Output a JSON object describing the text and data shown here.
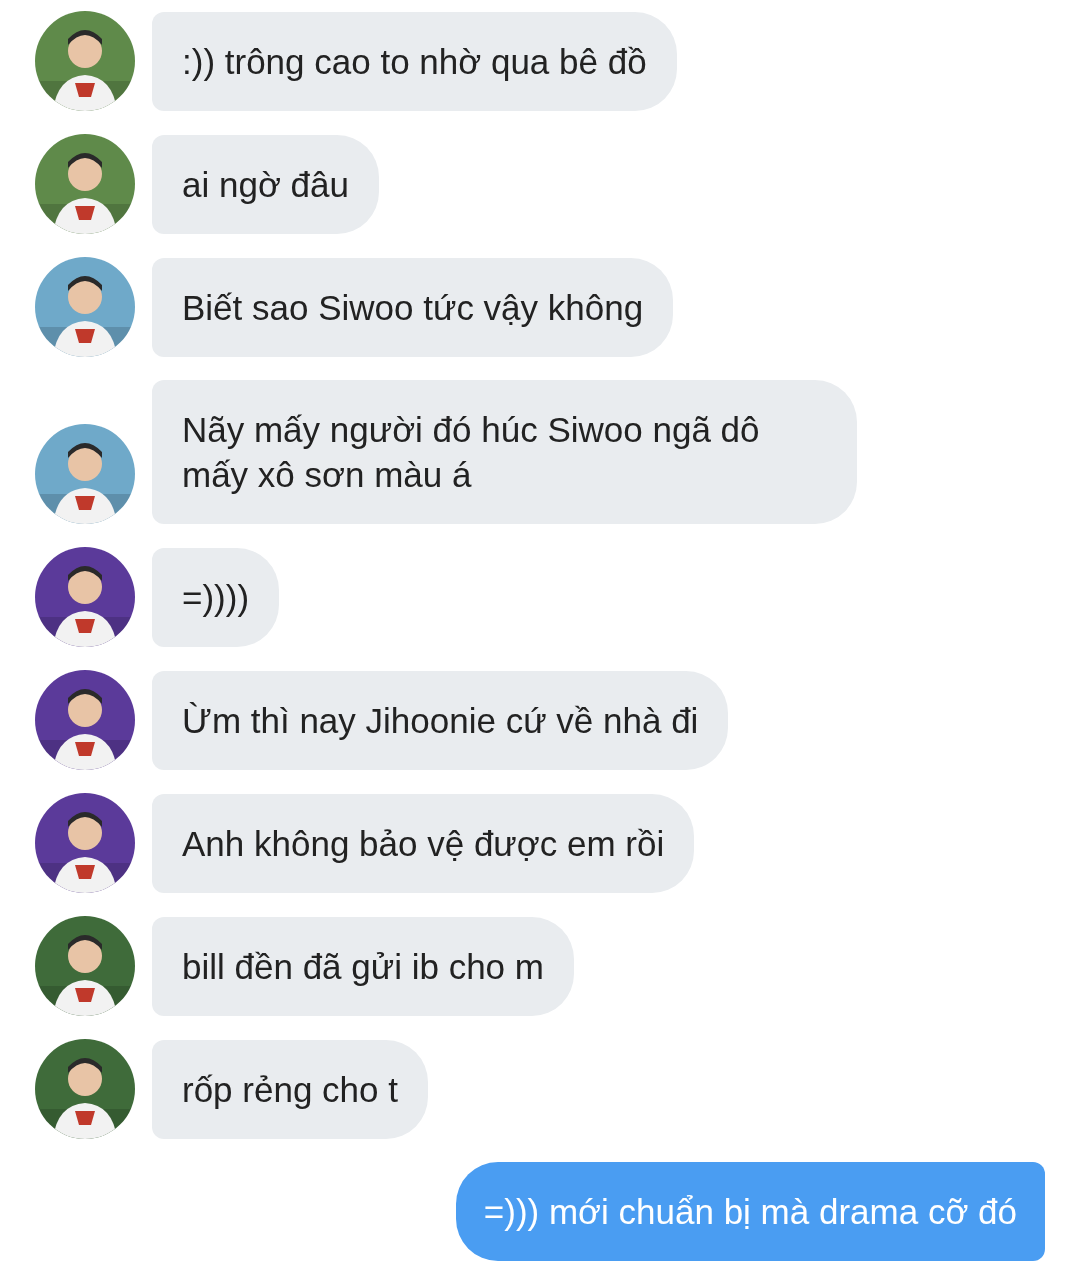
{
  "messages": [
    {
      "kind": "incoming",
      "text": ":)) trông cao to nhờ qua bê đồ"
    },
    {
      "kind": "incoming",
      "text": "ai ngờ đâu"
    },
    {
      "kind": "incoming",
      "text": "Biết sao Siwoo tức vậy không"
    },
    {
      "kind": "incoming",
      "text": "Nãy mấy người đó húc Siwoo ngã dô mấy xô sơn màu á"
    },
    {
      "kind": "incoming",
      "text": "=))))"
    },
    {
      "kind": "incoming",
      "text": "Ừm thì nay Jihoonie cứ về nhà đi"
    },
    {
      "kind": "incoming",
      "text": "Anh không bảo vệ được em rồi"
    },
    {
      "kind": "incoming",
      "text": "bill đền đã gửi ib cho m"
    },
    {
      "kind": "incoming",
      "text": "rốp rẻng cho t"
    },
    {
      "kind": "outgoing",
      "text": "=))) mới chuẩn bị mà drama cỡ đó"
    }
  ]
}
